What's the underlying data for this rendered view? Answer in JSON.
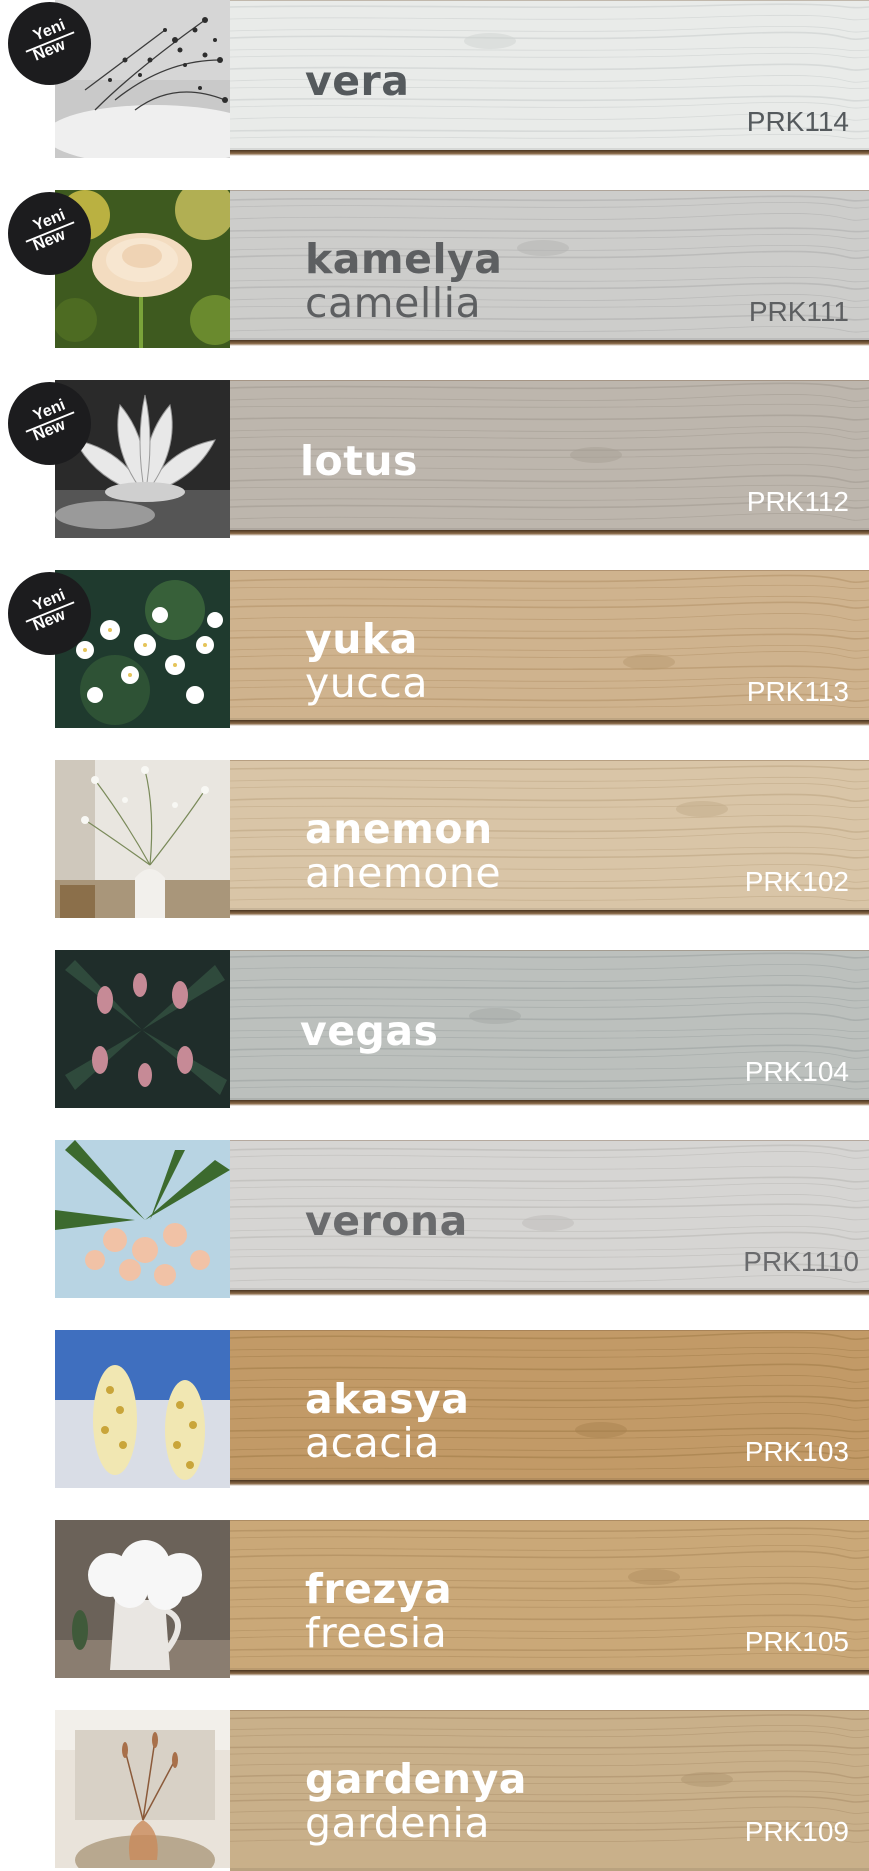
{
  "badge": {
    "line1": "Yeni",
    "line2": "New"
  },
  "products": [
    {
      "name_tr": "vera",
      "name_en": "",
      "code": "PRK114",
      "is_new": true,
      "wood_color": "#e9ebe9",
      "grain_color": "#cfd3d2",
      "text_color": "#555a5d",
      "photo": "white-gypsophila-on-plate"
    },
    {
      "name_tr": "kamelya",
      "name_en": "camellia",
      "code": "PRK111",
      "is_new": true,
      "wood_color": "#cdcdcb",
      "grain_color": "#b4b4b2",
      "text_color": "#5d5f61",
      "photo": "cream-ranunculus"
    },
    {
      "name_tr": "lotus",
      "name_en": "",
      "code": "PRK112",
      "is_new": true,
      "wood_color": "#bdb6ad",
      "grain_color": "#a79f95",
      "text_color": "#ffffff",
      "photo": "lotus-bw"
    },
    {
      "name_tr": "yuka",
      "name_en": "yucca",
      "code": "PRK113",
      "is_new": true,
      "wood_color": "#cfb38e",
      "grain_color": "#b8996f",
      "text_color": "#ffffff",
      "photo": "white-blossoms"
    },
    {
      "name_tr": "anemon",
      "name_en": "anemone",
      "code": "PRK102",
      "is_new": false,
      "wood_color": "#d9c5a7",
      "grain_color": "#c2ab89",
      "text_color": "#ffffff",
      "photo": "gypsophila-vase"
    },
    {
      "name_tr": "vegas",
      "name_en": "",
      "code": "PRK104",
      "is_new": false,
      "wood_color": "#bcc0bd",
      "grain_color": "#a3a8a6",
      "text_color": "#ffffff",
      "photo": "pink-bell-flowers"
    },
    {
      "name_tr": "verona",
      "name_en": "",
      "code": "PRK1110",
      "is_new": false,
      "wood_color": "#d6d5d3",
      "grain_color": "#bebcb9",
      "text_color": "#6a6b6d",
      "photo": "oleander"
    },
    {
      "name_tr": "akasya",
      "name_en": "acacia",
      "code": "PRK103",
      "is_new": false,
      "wood_color": "#c29a67",
      "grain_color": "#a7824f",
      "text_color": "#ffffff",
      "photo": "acacia-blossom"
    },
    {
      "name_tr": "frezya",
      "name_en": "freesia",
      "code": "PRK105",
      "is_new": false,
      "wood_color": "#caa878",
      "grain_color": "#b08e5f",
      "text_color": "#ffffff",
      "photo": "white-hydrangea-jug"
    },
    {
      "name_tr": "gardenya",
      "name_en": "gardenia",
      "code": "PRK109",
      "is_new": false,
      "wood_color": "#c9b08a",
      "grain_color": "#b09670",
      "text_color": "#ffffff",
      "photo": "dried-flowers-vase"
    }
  ]
}
